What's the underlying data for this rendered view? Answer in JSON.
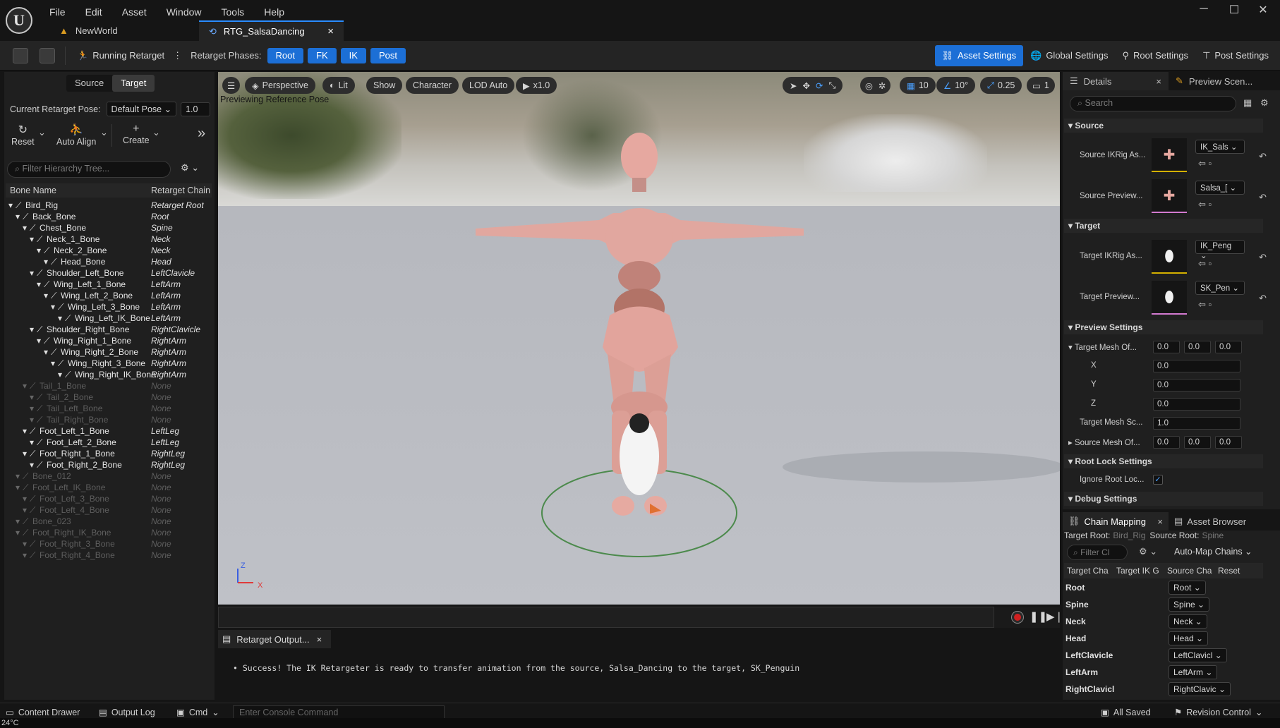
{
  "app": {
    "logo": "U"
  },
  "menu": [
    "File",
    "Edit",
    "Asset",
    "Window",
    "Tools",
    "Help"
  ],
  "window_controls": {
    "minimize": "─",
    "maximize": "☐",
    "close": "✕"
  },
  "tabs": [
    {
      "label": "NewWorld"
    },
    {
      "label": "RTG_SalsaDancing",
      "close": "×"
    }
  ],
  "toolbar": {
    "running_label": "Running Retarget",
    "phases_label": "Retarget Phases:",
    "phases": [
      "Root",
      "FK",
      "IK",
      "Post"
    ],
    "asset_settings": "Asset Settings",
    "global_settings": "Global Settings",
    "root_settings": "Root Settings",
    "post_settings": "Post Settings"
  },
  "left": {
    "source_tab": "Source",
    "target_tab": "Target",
    "pose_label": "Current Retarget Pose:",
    "pose_value": "Default Pose",
    "pose_scale": "1.0",
    "tools": {
      "reset": "Reset",
      "auto_align": "Auto Align",
      "create": "Create"
    },
    "search_placeholder": "Filter Hierarchy Tree...",
    "col_bone": "Bone Name",
    "col_chain": "Retarget Chain",
    "bones": [
      {
        "name": "Bird_Rig",
        "chain": "Retarget Root",
        "dim": false,
        "depth": 0
      },
      {
        "name": "Back_Bone",
        "chain": "Root",
        "dim": false,
        "depth": 1
      },
      {
        "name": "Chest_Bone",
        "chain": "Spine",
        "dim": false,
        "depth": 2
      },
      {
        "name": "Neck_1_Bone",
        "chain": "Neck",
        "dim": false,
        "depth": 3
      },
      {
        "name": "Neck_2_Bone",
        "chain": "Neck",
        "dim": false,
        "depth": 4
      },
      {
        "name": "Head_Bone",
        "chain": "Head",
        "dim": false,
        "depth": 5
      },
      {
        "name": "Shoulder_Left_Bone",
        "chain": "LeftClavicle",
        "dim": false,
        "depth": 3
      },
      {
        "name": "Wing_Left_1_Bone",
        "chain": "LeftArm",
        "dim": false,
        "depth": 4
      },
      {
        "name": "Wing_Left_2_Bone",
        "chain": "LeftArm",
        "dim": false,
        "depth": 5
      },
      {
        "name": "Wing_Left_3_Bone",
        "chain": "LeftArm",
        "dim": false,
        "depth": 6
      },
      {
        "name": "Wing_Left_IK_Bone",
        "chain": "LeftArm",
        "dim": false,
        "depth": 7
      },
      {
        "name": "Shoulder_Right_Bone",
        "chain": "RightClavicle",
        "dim": false,
        "depth": 3
      },
      {
        "name": "Wing_Right_1_Bone",
        "chain": "RightArm",
        "dim": false,
        "depth": 4
      },
      {
        "name": "Wing_Right_2_Bone",
        "chain": "RightArm",
        "dim": false,
        "depth": 5
      },
      {
        "name": "Wing_Right_3_Bone",
        "chain": "RightArm",
        "dim": false,
        "depth": 6
      },
      {
        "name": "Wing_Right_IK_Bone",
        "chain": "RightArm",
        "dim": false,
        "depth": 7
      },
      {
        "name": "Tail_1_Bone",
        "chain": "None",
        "dim": true,
        "depth": 2
      },
      {
        "name": "Tail_2_Bone",
        "chain": "None",
        "dim": true,
        "depth": 3
      },
      {
        "name": "Tail_Left_Bone",
        "chain": "None",
        "dim": true,
        "depth": 3
      },
      {
        "name": "Tail_Right_Bone",
        "chain": "None",
        "dim": true,
        "depth": 3
      },
      {
        "name": "Foot_Left_1_Bone",
        "chain": "LeftLeg",
        "dim": false,
        "depth": 2
      },
      {
        "name": "Foot_Left_2_Bone",
        "chain": "LeftLeg",
        "dim": false,
        "depth": 3
      },
      {
        "name": "Foot_Right_1_Bone",
        "chain": "RightLeg",
        "dim": false,
        "depth": 2
      },
      {
        "name": "Foot_Right_2_Bone",
        "chain": "RightLeg",
        "dim": false,
        "depth": 3
      },
      {
        "name": "Bone_012",
        "chain": "None",
        "dim": true,
        "depth": 1
      },
      {
        "name": "Foot_Left_IK_Bone",
        "chain": "None",
        "dim": true,
        "depth": 1
      },
      {
        "name": "Foot_Left_3_Bone",
        "chain": "None",
        "dim": true,
        "depth": 2
      },
      {
        "name": "Foot_Left_4_Bone",
        "chain": "None",
        "dim": true,
        "depth": 2
      },
      {
        "name": "Bone_023",
        "chain": "None",
        "dim": true,
        "depth": 1
      },
      {
        "name": "Foot_Right_IK_Bone",
        "chain": "None",
        "dim": true,
        "depth": 1
      },
      {
        "name": "Foot_Right_3_Bone",
        "chain": "None",
        "dim": true,
        "depth": 2
      },
      {
        "name": "Foot_Right_4_Bone",
        "chain": "None",
        "dim": true,
        "depth": 2
      }
    ]
  },
  "viewport": {
    "perspective": "Perspective",
    "lit": "Lit",
    "show": "Show",
    "character": "Character",
    "lod": "LOD Auto",
    "speed": "x1.0",
    "grid_snap": "10",
    "rot_snap": "10°",
    "scale_snap": "0.25",
    "cam_speed": "1",
    "preview_label": "Previewing Reference Pose",
    "axis_z": "Z",
    "axis_x": "X"
  },
  "output": {
    "tab": "Retarget Output...",
    "message": "Success! The IK Retargeter is ready to transfer animation from the source, Salsa_Dancing to the target, SK_Penguin"
  },
  "details": {
    "tab": "Details",
    "tab2": "Preview Scen...",
    "search_placeholder": "Search",
    "source_header": "Source",
    "source_ikrig_label": "Source IKRig As...",
    "source_ikrig_value": "IK_Sals",
    "source_preview_label": "Source Preview...",
    "source_preview_value": "Salsa_[",
    "target_header": "Target",
    "target_ikrig_label": "Target IKRig As...",
    "target_ikrig_value": "IK_Peng",
    "target_preview_label": "Target Preview...",
    "target_preview_value": "SK_Pen",
    "preview_header": "Preview Settings",
    "mesh_offset_label": "Target Mesh Of...",
    "mesh_offset": [
      "0.0",
      "0.0",
      "0.0"
    ],
    "x_label": "X",
    "x_value": "0.0",
    "y_label": "Y",
    "y_value": "0.0",
    "z_label": "Z",
    "z_value": "0.0",
    "mesh_scale_label": "Target Mesh Sc...",
    "mesh_scale": "1.0",
    "source_offset_label": "Source Mesh Of...",
    "source_offset": [
      "0.0",
      "0.0",
      "0.0"
    ],
    "rootlock_header": "Root Lock Settings",
    "ignore_root_label": "Ignore Root Loc...",
    "debug_header": "Debug Settings"
  },
  "chain_mapping": {
    "tab": "Chain Mapping",
    "tab2": "Asset Browser",
    "target_root_label": "Target Root:",
    "target_root_value": "Bird_Rig",
    "source_root_label": "Source Root:",
    "source_root_value": "Spine",
    "filter_placeholder": "Filter Cl",
    "automap": "Auto-Map Chains",
    "cols": [
      "Target Cha",
      "Target IK G",
      "Source Cha",
      "Reset"
    ],
    "rows": [
      {
        "target": "Root",
        "source": "Root"
      },
      {
        "target": "Spine",
        "source": "Spine"
      },
      {
        "target": "Neck",
        "source": "Neck"
      },
      {
        "target": "Head",
        "source": "Head"
      },
      {
        "target": "LeftClavicle",
        "source": "LeftClavicl"
      },
      {
        "target": "LeftArm",
        "source": "LeftArm"
      },
      {
        "target": "RightClavicl",
        "source": "RightClavic"
      }
    ]
  },
  "bottom": {
    "content_drawer": "Content Drawer",
    "output_log": "Output Log",
    "cmd": "Cmd",
    "console_placeholder": "Enter Console Command",
    "all_saved": "All Saved",
    "revision": "Revision Control",
    "temp": "24°C"
  },
  "colors": {
    "accent": "#1c6fd6",
    "bg": "#151515",
    "panel": "#1f1f1f",
    "yellow": "#d4b000",
    "pink": "#d27ad0"
  }
}
